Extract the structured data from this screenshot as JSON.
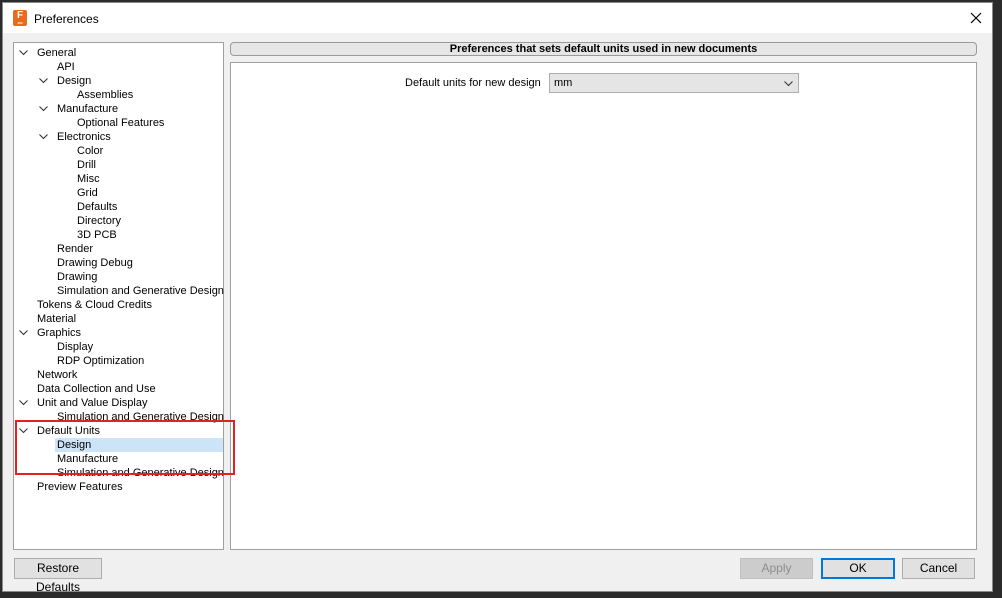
{
  "window": {
    "title": "Preferences",
    "app_icon_letter": "F",
    "app_icon_sub": "360"
  },
  "tree": [
    {
      "label": "General",
      "level": 0,
      "expanded": true
    },
    {
      "label": "API",
      "level": 1
    },
    {
      "label": "Design",
      "level": 1,
      "expanded": true
    },
    {
      "label": "Assemblies",
      "level": 2
    },
    {
      "label": "Manufacture",
      "level": 1,
      "expanded": true
    },
    {
      "label": "Optional Features",
      "level": 2
    },
    {
      "label": "Electronics",
      "level": 1,
      "expanded": true
    },
    {
      "label": "Color",
      "level": 2
    },
    {
      "label": "Drill",
      "level": 2
    },
    {
      "label": "Misc",
      "level": 2
    },
    {
      "label": "Grid",
      "level": 2
    },
    {
      "label": "Defaults",
      "level": 2
    },
    {
      "label": "Directory",
      "level": 2
    },
    {
      "label": "3D PCB",
      "level": 2
    },
    {
      "label": "Render",
      "level": 1
    },
    {
      "label": "Drawing Debug",
      "level": 1
    },
    {
      "label": "Drawing",
      "level": 1
    },
    {
      "label": "Simulation and Generative Design",
      "level": 1
    },
    {
      "label": "Tokens & Cloud Credits",
      "level": 0
    },
    {
      "label": "Material",
      "level": 0
    },
    {
      "label": "Graphics",
      "level": 0,
      "expanded": true
    },
    {
      "label": "Display",
      "level": 1
    },
    {
      "label": "RDP Optimization",
      "level": 1
    },
    {
      "label": "Network",
      "level": 0
    },
    {
      "label": "Data Collection and Use",
      "level": 0
    },
    {
      "label": "Unit and Value Display",
      "level": 0,
      "expanded": true
    },
    {
      "label": "Simulation and Generative Design",
      "level": 1
    },
    {
      "label": "Default Units",
      "level": 0,
      "expanded": true
    },
    {
      "label": "Design",
      "level": 1,
      "selected": true
    },
    {
      "label": "Manufacture",
      "level": 1
    },
    {
      "label": "Simulation and Generative Design",
      "level": 1
    },
    {
      "label": "Preview Features",
      "level": 0
    }
  ],
  "content": {
    "header": "Preferences that sets default units used in new documents",
    "units_label": "Default units for new design",
    "units_value": "mm"
  },
  "buttons": {
    "restore": "Restore Defaults",
    "apply": "Apply",
    "ok": "OK",
    "cancel": "Cancel"
  },
  "colors": {
    "selection": "#cce4f7",
    "highlight_box": "#e5211c",
    "ok_border": "#0078d7",
    "app_icon": "#e86a1e"
  }
}
